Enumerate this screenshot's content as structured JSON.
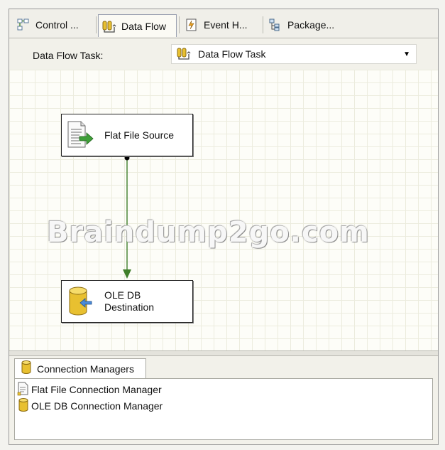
{
  "tabs": [
    {
      "label": "Control ...",
      "icon": "control-flow-icon",
      "active": false
    },
    {
      "label": "Data Flow",
      "icon": "data-flow-icon",
      "active": true
    },
    {
      "label": "Event H...",
      "icon": "event-handlers-icon",
      "active": false
    },
    {
      "label": "Package...",
      "icon": "package-explorer-icon",
      "active": false
    }
  ],
  "task_selector": {
    "label": "Data Flow Task:",
    "value": "Data Flow Task",
    "icon": "data-flow-task-icon"
  },
  "canvas": {
    "components": [
      {
        "label": "Flat File Source",
        "icon": "flat-file-source-icon"
      },
      {
        "label": "OLE DB\nDestination",
        "icon": "ole-db-destination-icon"
      }
    ],
    "path_colors": {
      "line": "#3f7f2a",
      "start_dot": "#000000",
      "arrowhead": "#3f7f2a"
    },
    "watermark": "Braindump2go.com"
  },
  "connection_managers": {
    "tab_label": "Connection Managers",
    "items": [
      {
        "label": "Flat File Connection Manager",
        "icon": "flat-file-connection-icon"
      },
      {
        "label": "OLE DB Connection Manager",
        "icon": "ole-db-connection-icon"
      }
    ]
  },
  "colors": {
    "canvas_background": "#fdfdf8",
    "grid_line": "#ececde",
    "tab_strip": "#f0efe9",
    "selection_border": "#9aa0b0"
  }
}
